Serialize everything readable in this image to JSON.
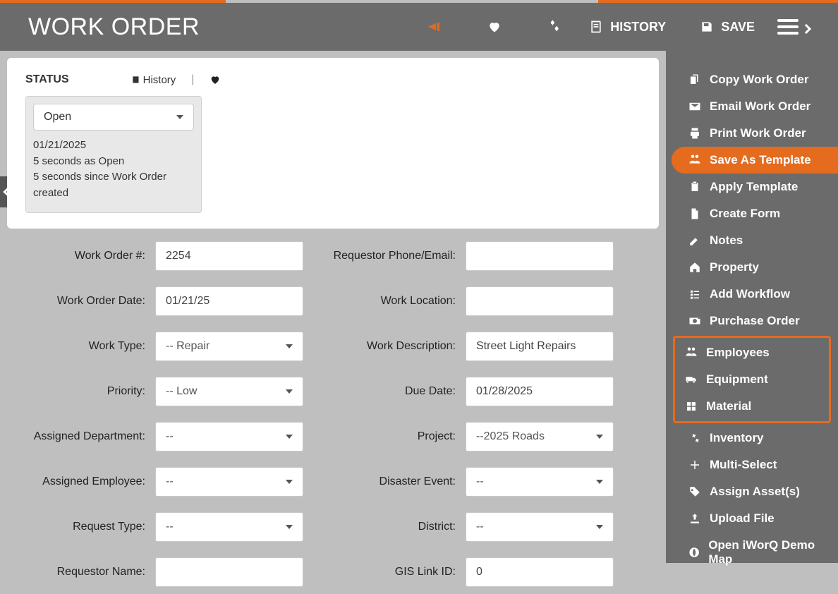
{
  "header": {
    "title": "WORK ORDER",
    "history": "HISTORY",
    "save": "SAVE"
  },
  "status": {
    "title": "STATUS",
    "history_link": "History",
    "value": "Open",
    "date": "01/21/2025",
    "line1": "5 seconds as Open",
    "line2": "5 seconds since Work Order created"
  },
  "form": {
    "left": [
      {
        "label": "Work Order #:",
        "value": "2254",
        "type": "input",
        "name": "work-order-number"
      },
      {
        "label": "Work Order Date:",
        "value": "01/21/25",
        "type": "input",
        "name": "work-order-date"
      },
      {
        "label": "Work Type:",
        "value": "-- Repair",
        "type": "select",
        "name": "work-type"
      },
      {
        "label": "Priority:",
        "value": "-- Low",
        "type": "select",
        "name": "priority"
      },
      {
        "label": "Assigned Department:",
        "value": "--",
        "type": "select",
        "name": "assigned-department"
      },
      {
        "label": "Assigned Employee:",
        "value": "--",
        "type": "select",
        "name": "assigned-employee"
      },
      {
        "label": "Request Type:",
        "value": "--",
        "type": "select",
        "name": "request-type"
      },
      {
        "label": "Requestor Name:",
        "value": "",
        "type": "input",
        "name": "requestor-name"
      }
    ],
    "right": [
      {
        "label": "Requestor Phone/Email:",
        "value": "",
        "type": "input",
        "name": "requestor-phone-email"
      },
      {
        "label": "Work Location:",
        "value": "",
        "type": "input",
        "name": "work-location"
      },
      {
        "label": "Work Description:",
        "value": "Street Light Repairs",
        "type": "input",
        "name": "work-description"
      },
      {
        "label": "Due Date:",
        "value": "01/28/2025",
        "type": "input",
        "name": "due-date"
      },
      {
        "label": "Project:",
        "value": "--2025 Roads",
        "type": "select",
        "name": "project"
      },
      {
        "label": "Disaster Event:",
        "value": "--",
        "type": "select",
        "name": "disaster-event"
      },
      {
        "label": "District:",
        "value": "--",
        "type": "select",
        "name": "district"
      },
      {
        "label": "GIS Link ID:",
        "value": "0",
        "type": "input",
        "name": "gis-link-id"
      }
    ]
  },
  "menu": {
    "items": [
      {
        "label": "Copy Work Order",
        "icon": "copy",
        "name": "menu-copy-work-order"
      },
      {
        "label": "Email Work Order",
        "icon": "mail",
        "name": "menu-email-work-order"
      },
      {
        "label": "Print Work Order",
        "icon": "print",
        "name": "menu-print-work-order"
      },
      {
        "label": "Save As Template",
        "icon": "users",
        "name": "menu-save-as-template",
        "active": true
      },
      {
        "label": "Apply Template",
        "icon": "paste",
        "name": "menu-apply-template"
      },
      {
        "label": "Create Form",
        "icon": "file",
        "name": "menu-create-form"
      },
      {
        "label": "Notes",
        "icon": "edit",
        "name": "menu-notes"
      },
      {
        "label": "Property",
        "icon": "home",
        "name": "menu-property"
      },
      {
        "label": "Add Workflow",
        "icon": "list",
        "name": "menu-add-workflow"
      },
      {
        "label": "Purchase Order",
        "icon": "money",
        "name": "menu-purchase-order"
      }
    ],
    "group": [
      {
        "label": "Employees",
        "icon": "users",
        "name": "menu-employees"
      },
      {
        "label": "Equipment",
        "icon": "truck",
        "name": "menu-equipment"
      },
      {
        "label": "Material",
        "icon": "boxes",
        "name": "menu-material"
      }
    ],
    "items2": [
      {
        "label": "Inventory",
        "icon": "gears",
        "name": "menu-inventory"
      },
      {
        "label": "Multi-Select",
        "icon": "plus",
        "name": "menu-multi-select"
      },
      {
        "label": "Assign Asset(s)",
        "icon": "tag",
        "name": "menu-assign-assets"
      },
      {
        "label": "Upload File",
        "icon": "upload",
        "name": "menu-upload-file"
      },
      {
        "label": "Open iWorQ Demo Map",
        "icon": "globe",
        "name": "menu-open-map"
      }
    ]
  }
}
